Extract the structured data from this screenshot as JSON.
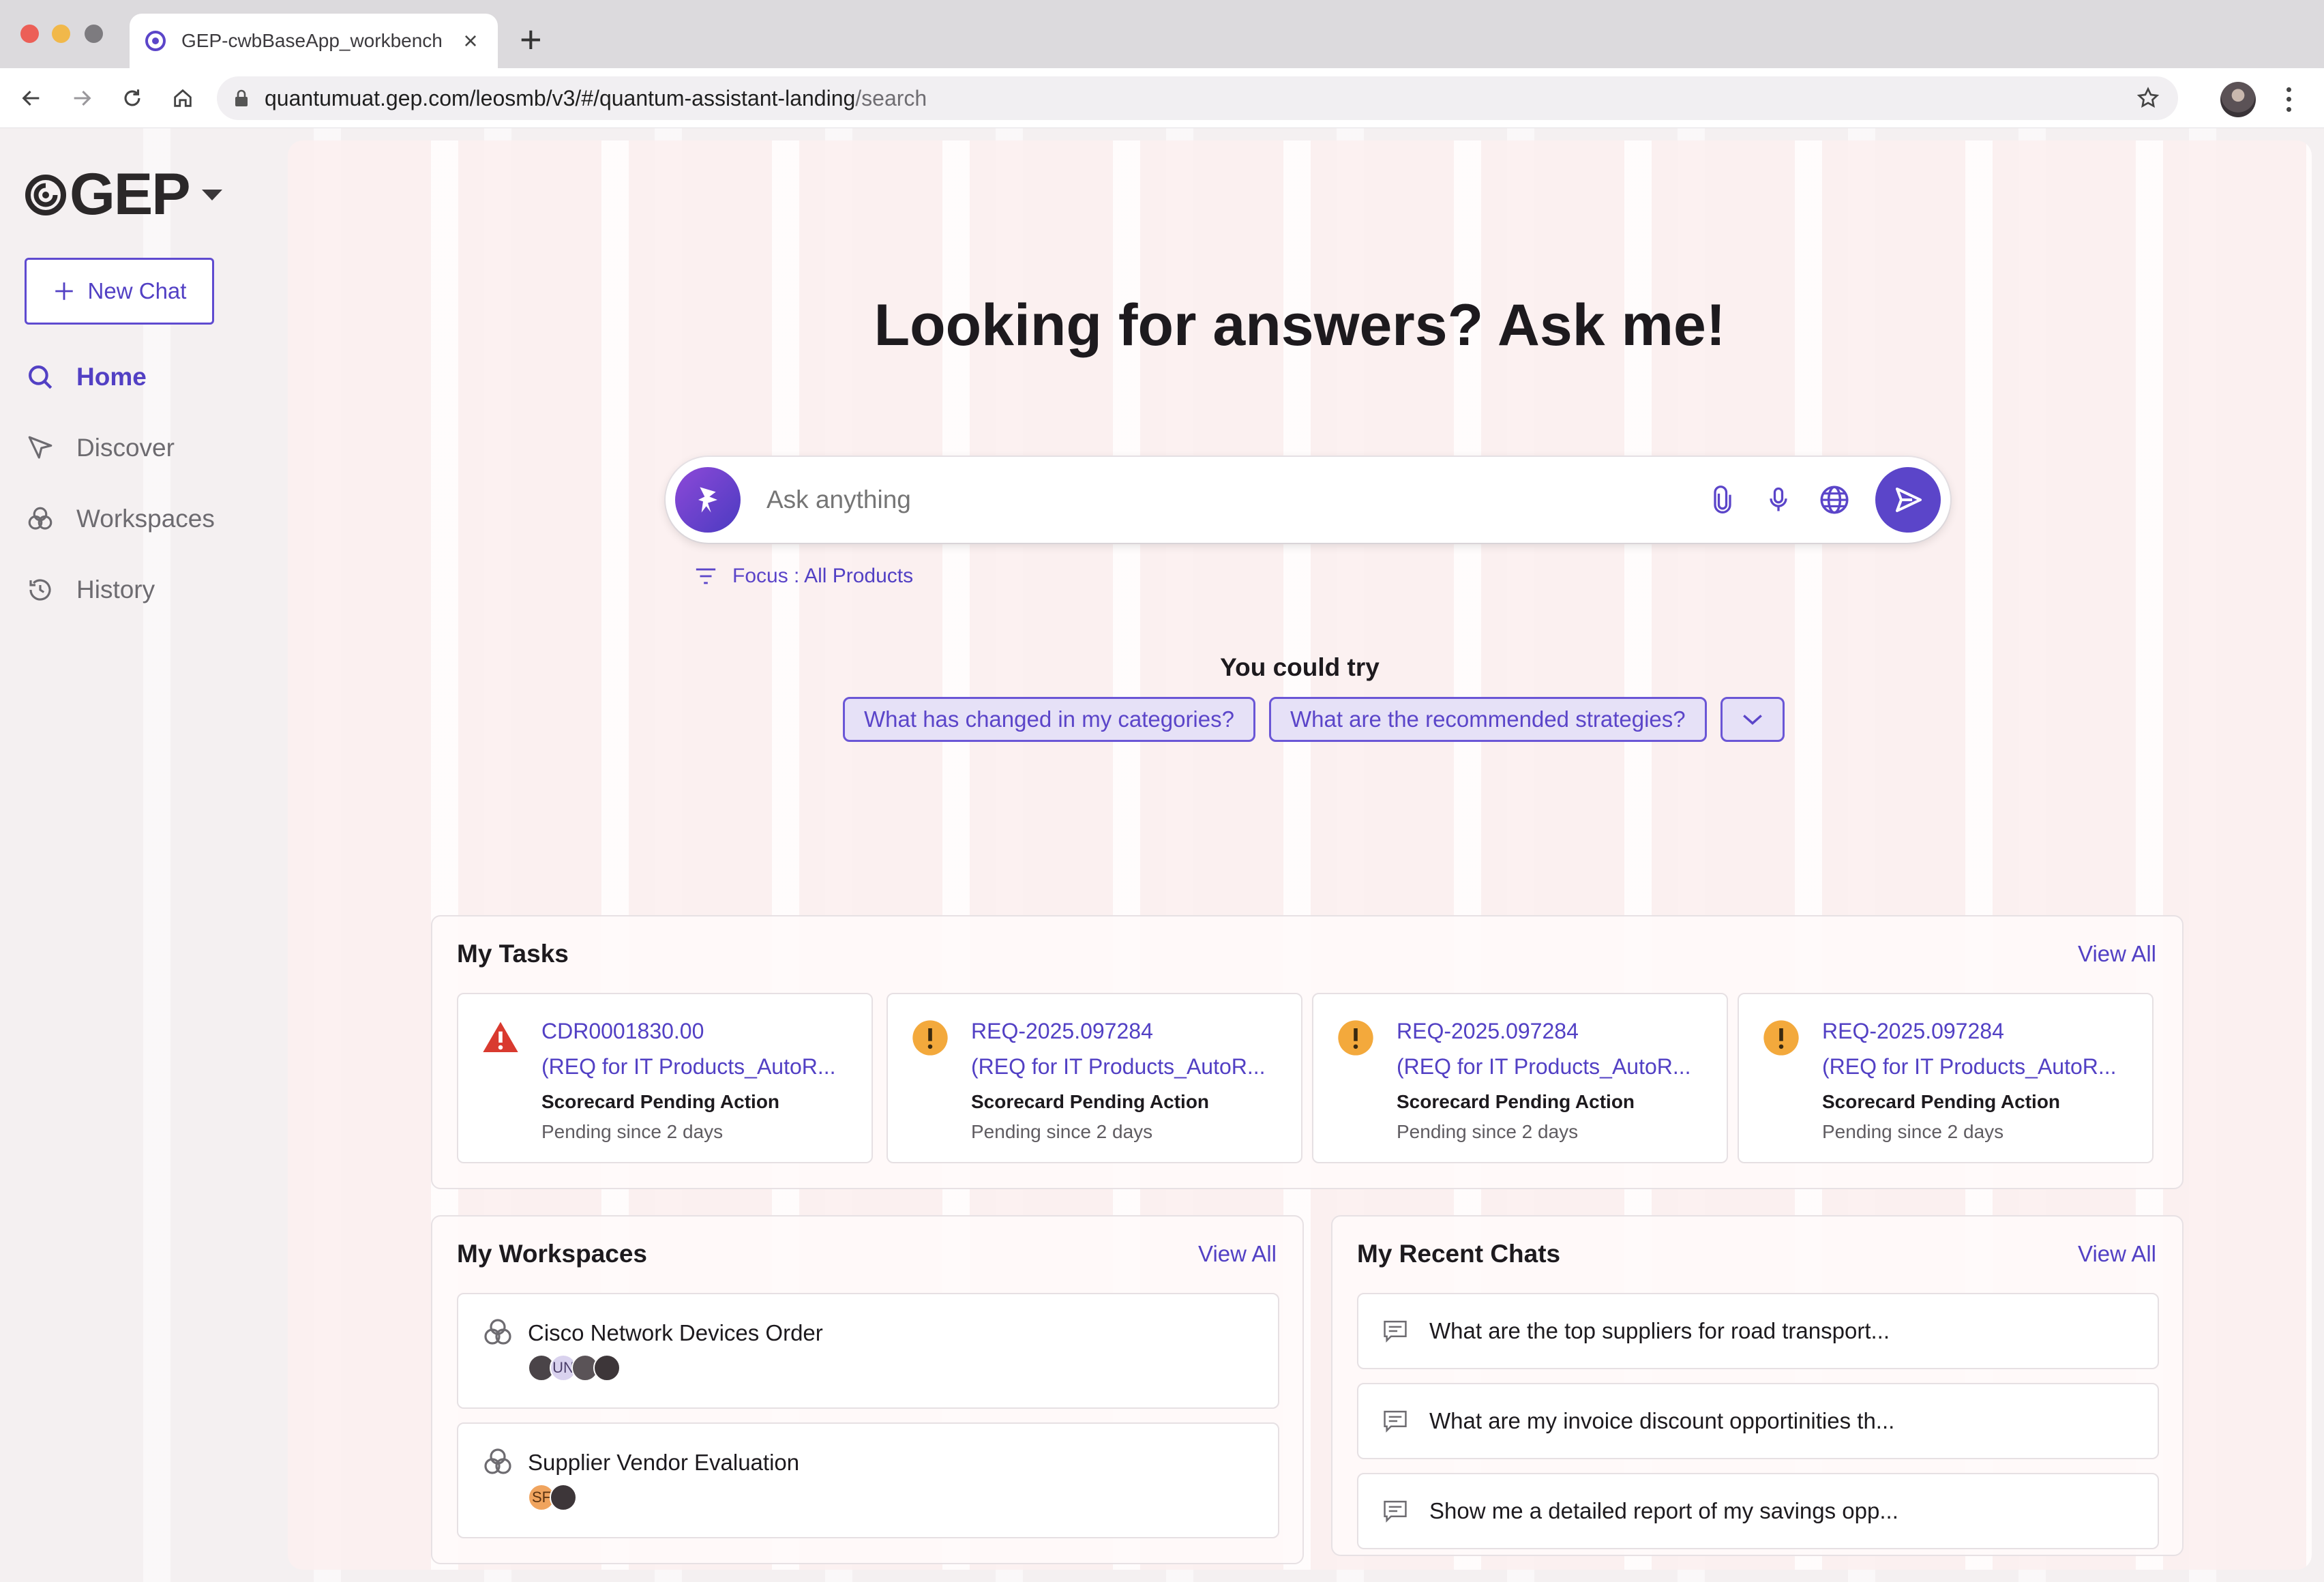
{
  "browser": {
    "tab_title": "GEP-cwbBaseApp_workbench",
    "url_main": "quantumuat.gep.com/leosmb/v3/#/quantum-assistant-landing",
    "url_path": "/search"
  },
  "sidebar": {
    "logo_text": "GEP",
    "new_chat_label": "New Chat",
    "items": [
      {
        "label": "Home",
        "icon": "search-icon",
        "active": true
      },
      {
        "label": "Discover",
        "icon": "send-arrow-icon",
        "active": false
      },
      {
        "label": "Workspaces",
        "icon": "workspaces-icon",
        "active": false
      },
      {
        "label": "History",
        "icon": "history-icon",
        "active": false
      }
    ]
  },
  "hero": {
    "title": "Looking for answers? Ask me!"
  },
  "ask": {
    "placeholder": "Ask anything",
    "focus_label": "Focus :",
    "focus_value": "All Products"
  },
  "suggestions": {
    "title": "You could try",
    "chips": [
      "What has changed in my categories?",
      "What are the recommended strategies?"
    ]
  },
  "tasks": {
    "title": "My Tasks",
    "view_all": "View All",
    "items": [
      {
        "id": "CDR0001830.00",
        "desc": "(REQ for IT Products_AutoR...",
        "status": "Scorecard Pending Action",
        "since": "Pending since 2 days",
        "severity": "error"
      },
      {
        "id": "REQ-2025.097284",
        "desc": "(REQ for IT Products_AutoR...",
        "status": "Scorecard Pending Action",
        "since": "Pending since 2 days",
        "severity": "warning"
      },
      {
        "id": "REQ-2025.097284",
        "desc": "(REQ for IT Products_AutoR...",
        "status": "Scorecard Pending Action",
        "since": "Pending since 2 days",
        "severity": "warning"
      },
      {
        "id": "REQ-2025.097284",
        "desc": "(REQ for IT Products_AutoR...",
        "status": "Scorecard Pending Action",
        "since": "Pending since 2 days",
        "severity": "warning"
      }
    ]
  },
  "workspaces": {
    "title": "My Workspaces",
    "view_all": "View All",
    "items": [
      {
        "name": "Cisco Network Devices Order",
        "avatar_initials": [
          "",
          "UN",
          "",
          ""
        ]
      },
      {
        "name": "Supplier Vendor Evaluation",
        "avatar_initials": [
          "SF",
          ""
        ]
      }
    ]
  },
  "recent_chats": {
    "title": "My Recent Chats",
    "view_all": "View All",
    "items": [
      "What are the top suppliers for road transport...",
      "What are my invoice discount opportinities th...",
      "Show me a detailed report of my savings opp..."
    ]
  },
  "colors": {
    "accent": "#5240c4",
    "error": "#d93a2f",
    "warning": "#f3a93c"
  }
}
